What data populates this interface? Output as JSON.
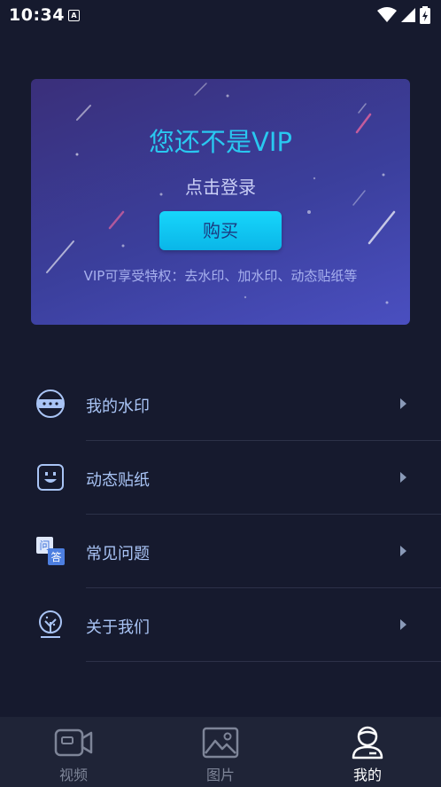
{
  "status_bar": {
    "time": "10:34",
    "notification_icon": "A"
  },
  "vip_card": {
    "title": "您还不是VIP",
    "login_label": "点击登录",
    "buy_label": "购买",
    "perks": "VIP可享受特权：去水印、加水印、动态贴纸等"
  },
  "menu": {
    "items": [
      {
        "label": "我的水印",
        "icon": "watermark-badge-icon"
      },
      {
        "label": "动态贴纸",
        "icon": "smiley-sticker-icon"
      },
      {
        "label": "常见问题",
        "icon": "faq-icon"
      },
      {
        "label": "关于我们",
        "icon": "tree-icon"
      }
    ]
  },
  "bottom_nav": {
    "tabs": [
      {
        "label": "视频",
        "icon": "video-camera-icon",
        "active": false
      },
      {
        "label": "图片",
        "icon": "image-icon",
        "active": false
      },
      {
        "label": "我的",
        "icon": "profile-icon",
        "active": true
      }
    ]
  },
  "colors": {
    "background": "#161a2e",
    "accent": "#29c8f0",
    "menu_text": "#a9c4f5"
  }
}
